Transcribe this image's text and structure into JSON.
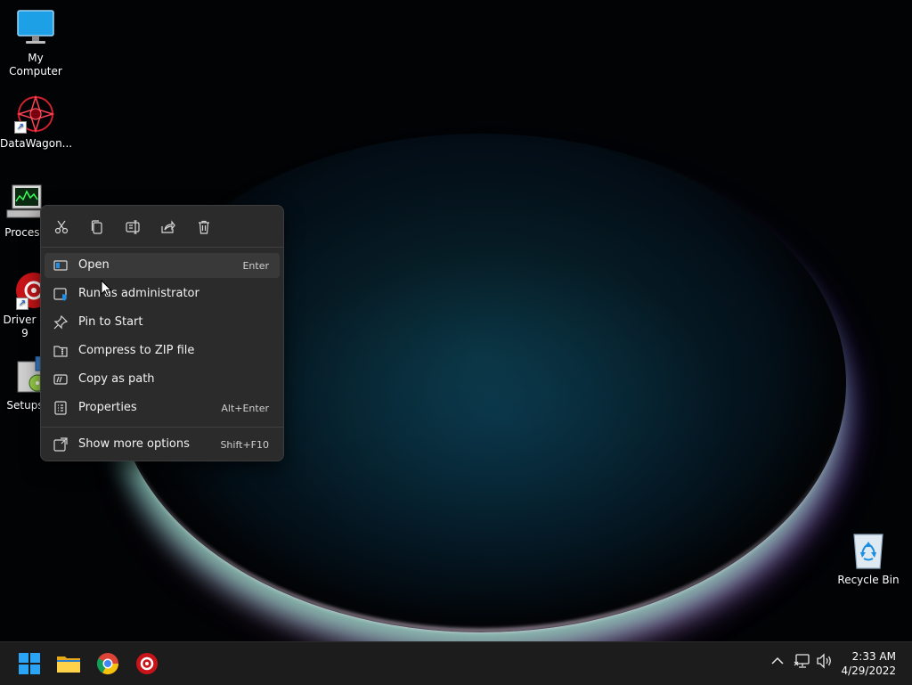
{
  "desktop": {
    "icons": [
      {
        "label": "My Computer",
        "icon": "monitor-icon"
      },
      {
        "label": "DataWagon...",
        "icon": "datawagon-icon"
      },
      {
        "label": "Process",
        "icon": "process-monitor-icon"
      },
      {
        "label": "Driver B",
        "sublabel": "9",
        "icon": "driver-booster-icon"
      },
      {
        "label": "Setups",
        "icon": "setup-icon"
      },
      {
        "label": "Recycle Bin",
        "icon": "recycle-bin-icon"
      }
    ]
  },
  "context_menu": {
    "toolbar": [
      {
        "name": "cut",
        "icon": "scissors-icon"
      },
      {
        "name": "copy",
        "icon": "copy-icon"
      },
      {
        "name": "rename",
        "icon": "rename-icon"
      },
      {
        "name": "share",
        "icon": "share-icon"
      },
      {
        "name": "delete",
        "icon": "trash-icon"
      }
    ],
    "items": [
      {
        "label": "Open",
        "shortcut": "Enter",
        "icon": "open-window-icon",
        "hover": true
      },
      {
        "label": "Run as administrator",
        "shortcut": "",
        "icon": "shield-window-icon"
      },
      {
        "label": "Pin to Start",
        "shortcut": "",
        "icon": "pin-icon"
      },
      {
        "label": "Compress to ZIP file",
        "shortcut": "",
        "icon": "zip-folder-icon"
      },
      {
        "label": "Copy as path",
        "shortcut": "",
        "icon": "copy-path-icon"
      },
      {
        "label": "Properties",
        "shortcut": "Alt+Enter",
        "icon": "properties-icon"
      }
    ],
    "more": {
      "label": "Show more options",
      "shortcut": "Shift+F10",
      "icon": "more-options-icon"
    }
  },
  "taskbar": {
    "apps": [
      {
        "name": "start",
        "icon": "windows-start-icon"
      },
      {
        "name": "file-explorer",
        "icon": "folder-icon"
      },
      {
        "name": "chrome",
        "icon": "chrome-icon"
      },
      {
        "name": "driver-booster",
        "icon": "driver-booster-icon"
      }
    ],
    "tray": [
      "chevron-up-icon",
      "network-icon",
      "volume-icon"
    ],
    "clock": {
      "time": "2:33 AM",
      "date": "4/29/2022"
    }
  },
  "colors": {
    "menu_bg": "#2b2b2b",
    "menu_hover": "#393939",
    "accent": "#0f8fe8",
    "taskbar_bg": "#1c1c1c"
  }
}
